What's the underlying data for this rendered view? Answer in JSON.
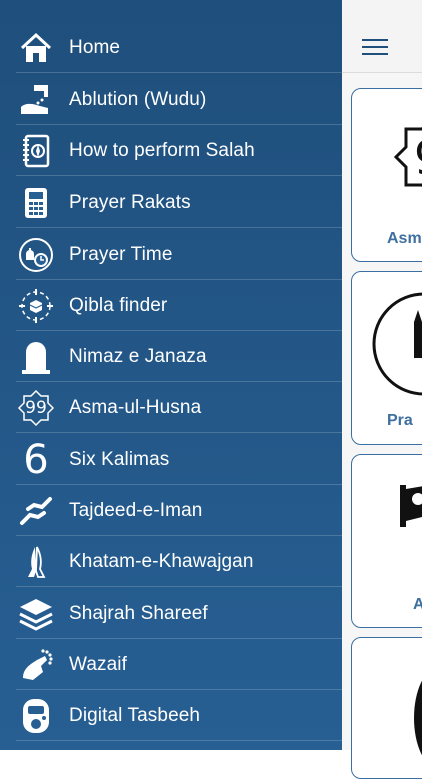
{
  "menu": {
    "items": [
      {
        "label": "Home",
        "icon": "home-icon"
      },
      {
        "label": "Ablution (Wudu)",
        "icon": "ablution-icon"
      },
      {
        "label": "How to perform Salah",
        "icon": "book-compass-icon"
      },
      {
        "label": "Prayer Rakats",
        "icon": "calculator-icon"
      },
      {
        "label": "Prayer Time",
        "icon": "mosque-clock-icon"
      },
      {
        "label": "Qibla finder",
        "icon": "kaaba-compass-icon"
      },
      {
        "label": "Nimaz e Janaza",
        "icon": "gravestone-icon"
      },
      {
        "label": "Asma-ul-Husna",
        "icon": "star-99-icon"
      },
      {
        "label": "Six Kalimas",
        "icon": "six-icon"
      },
      {
        "label": "Tajdeed-e-Iman",
        "icon": "hands-icon"
      },
      {
        "label": "Khatam-e-Khawajgan",
        "icon": "praying-hands-icon"
      },
      {
        "label": "Shajrah Shareef",
        "icon": "layers-icon"
      },
      {
        "label": "Wazaif",
        "icon": "rosary-hand-icon"
      },
      {
        "label": "Digital Tasbeeh",
        "icon": "counter-icon"
      }
    ]
  },
  "icon_text": {
    "asma_number": "99",
    "six_number": "6"
  },
  "background": {
    "cards": [
      {
        "label": "Asm"
      },
      {
        "label": "Pra"
      },
      {
        "label": "A"
      }
    ]
  },
  "colors": {
    "drawer": "#1f4f7c",
    "card_border": "#3b6fa1",
    "card_label": "#3f6f9f"
  }
}
